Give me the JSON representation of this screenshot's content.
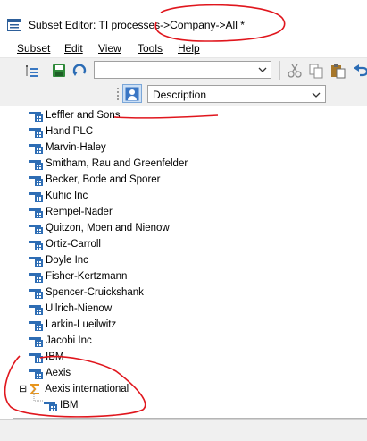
{
  "window": {
    "title": "Subset Editor:  TI processes->Company->All  *"
  },
  "menu": {
    "items": [
      "Subset",
      "Edit",
      "View",
      "Tools",
      "Help"
    ],
    "underlined_letters": [
      "S",
      "E",
      "V",
      "T",
      "H"
    ]
  },
  "toolbar": {
    "subset_combo_value": "",
    "icons": [
      "outline-icon",
      "save-icon",
      "refresh-icon",
      "cut-icon",
      "copy-icon",
      "paste-icon",
      "undo-icon"
    ]
  },
  "alias_bar": {
    "alias_value": "Description"
  },
  "elements": [
    {
      "label": "Leffler and Sons",
      "type": "leaf",
      "level": 0
    },
    {
      "label": "Hand PLC",
      "type": "leaf",
      "level": 0
    },
    {
      "label": "Marvin-Haley",
      "type": "leaf",
      "level": 0
    },
    {
      "label": "Smitham, Rau and Greenfelder",
      "type": "leaf",
      "level": 0
    },
    {
      "label": "Becker, Bode and Sporer",
      "type": "leaf",
      "level": 0
    },
    {
      "label": "Kuhic Inc",
      "type": "leaf",
      "level": 0
    },
    {
      "label": "Rempel-Nader",
      "type": "leaf",
      "level": 0
    },
    {
      "label": "Quitzon, Moen and Nienow",
      "type": "leaf",
      "level": 0
    },
    {
      "label": "Ortiz-Carroll",
      "type": "leaf",
      "level": 0
    },
    {
      "label": "Doyle Inc",
      "type": "leaf",
      "level": 0
    },
    {
      "label": "Fisher-Kertzmann",
      "type": "leaf",
      "level": 0
    },
    {
      "label": "Spencer-Cruickshank",
      "type": "leaf",
      "level": 0
    },
    {
      "label": "Ullrich-Nienow",
      "type": "leaf",
      "level": 0
    },
    {
      "label": "Larkin-Lueilwitz",
      "type": "leaf",
      "level": 0
    },
    {
      "label": "Jacobi Inc",
      "type": "leaf",
      "level": 0
    },
    {
      "label": "IBM",
      "type": "leaf",
      "level": 0
    },
    {
      "label": "Aexis",
      "type": "leaf",
      "level": 0
    },
    {
      "label": "Aexis international",
      "type": "consolidated",
      "level": 0,
      "expanded": true
    },
    {
      "label": "IBM",
      "type": "leaf",
      "level": 1
    }
  ],
  "tree_toggle": "⊟",
  "colors": {
    "annotation_red": "#e0161d",
    "element_icon_blue": "#2e6db4",
    "sigma_orange": "#e8951c"
  }
}
